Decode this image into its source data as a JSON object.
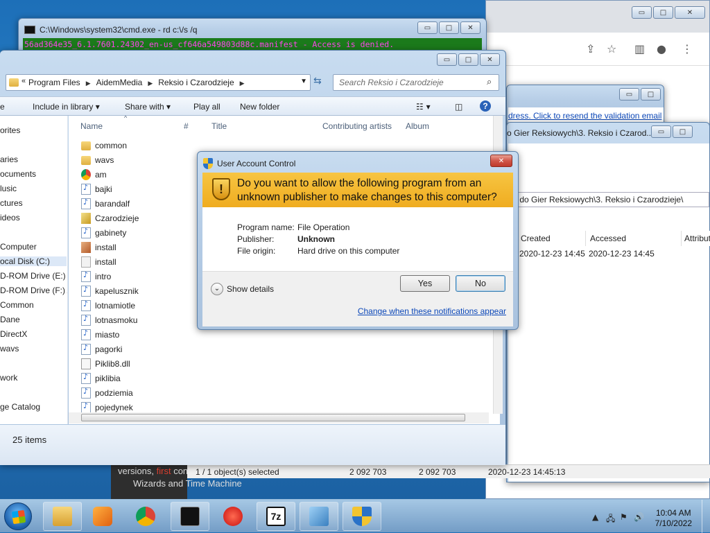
{
  "cmd": {
    "title": "C:\\Windows\\system32\\cmd.exe - rd  c:\\/s /q",
    "console_text": "56ad364e35_6.1.7601.24302_en-us_cf646a549803d88c.manifest - Access is denied."
  },
  "chrome": {
    "bg_link": "dress. Click to resend the validation email"
  },
  "zip": {
    "window_title": "o Gier Reksiowych\\3. Reksio i Czarod...",
    "path": "y do Gier Reksiowych\\3. Reksio i Czarodzieje\\",
    "columns": [
      "Created",
      "Accessed",
      "Attribut"
    ],
    "row": [
      "2020-12-23 14:45",
      "2020-12-23 14:45"
    ],
    "status": {
      "selected": "1 / 1 object(s) selected",
      "size": "2 092 703",
      "packed": "2 092 703",
      "modified": "2020-12-23 14:45:13"
    },
    "bg_text": [
      "versions, ",
      "first",
      " con",
      "Wizards and Time Machine"
    ]
  },
  "explorer": {
    "breadcrumb": [
      "Program Files",
      "AidemMedia",
      "Reksio i Czarodzieje"
    ],
    "search_placeholder": "Search Reksio i Czarodzieje",
    "commands": [
      "e",
      "Include in library",
      "Share with",
      "Play all",
      "New folder"
    ],
    "nav": [
      {
        "label": "orites",
        "sel": false
      },
      {
        "label": "aries",
        "sel": false
      },
      {
        "label": "ocuments",
        "sel": false
      },
      {
        "label": "lusic",
        "sel": false
      },
      {
        "label": "ctures",
        "sel": false
      },
      {
        "label": "ideos",
        "sel": false
      },
      {
        "label": "Computer",
        "sel": false
      },
      {
        "label": "ocal Disk (C:)",
        "sel": true
      },
      {
        "label": "D-ROM Drive (E:) A",
        "sel": false
      },
      {
        "label": "D-ROM Drive (F:) A",
        "sel": false
      },
      {
        "label": "Common",
        "sel": false
      },
      {
        "label": "Dane",
        "sel": false
      },
      {
        "label": "DirectX",
        "sel": false
      },
      {
        "label": "wavs",
        "sel": false
      },
      {
        "label": "work",
        "sel": false
      },
      {
        "label": "ge Catalog",
        "sel": false
      }
    ],
    "headers": [
      "Name",
      "#",
      "Title",
      "Contributing artists",
      "Album"
    ],
    "files": [
      {
        "name": "common",
        "icon": "folder"
      },
      {
        "name": "wavs",
        "icon": "folder"
      },
      {
        "name": "am",
        "icon": "chrome"
      },
      {
        "name": "bajki",
        "icon": "audio"
      },
      {
        "name": "barandalf",
        "icon": "audio"
      },
      {
        "name": "Czarodzieje",
        "icon": "exe"
      },
      {
        "name": "gabinety",
        "icon": "audio"
      },
      {
        "name": "install",
        "icon": "inst"
      },
      {
        "name": "install",
        "icon": "ini"
      },
      {
        "name": "intro",
        "icon": "audio"
      },
      {
        "name": "kapelusznik",
        "icon": "audio"
      },
      {
        "name": "lotnamiotle",
        "icon": "audio"
      },
      {
        "name": "lotnasmoku",
        "icon": "audio"
      },
      {
        "name": "miasto",
        "icon": "audio"
      },
      {
        "name": "pagorki",
        "icon": "audio"
      },
      {
        "name": "Piklib8.dll",
        "icon": "dll"
      },
      {
        "name": "piklibia",
        "icon": "audio"
      },
      {
        "name": "podziemia",
        "icon": "audio"
      },
      {
        "name": "pojedynek",
        "icon": "audio"
      }
    ],
    "item_count": "25 items"
  },
  "uac": {
    "title": "User Account Control",
    "question": "Do you want to allow the following program from an unknown publisher to make changes to this computer?",
    "program_name_label": "Program name:",
    "program_name": "File Operation",
    "publisher_label": "Publisher:",
    "publisher": "Unknown",
    "origin_label": "File origin:",
    "origin": "Hard drive on this computer",
    "show_details": "Show details",
    "yes": "Yes",
    "no": "No",
    "change_link": "Change when these notifications appear"
  },
  "taskbar": {
    "time": "10:04 AM",
    "date": "7/10/2022"
  }
}
